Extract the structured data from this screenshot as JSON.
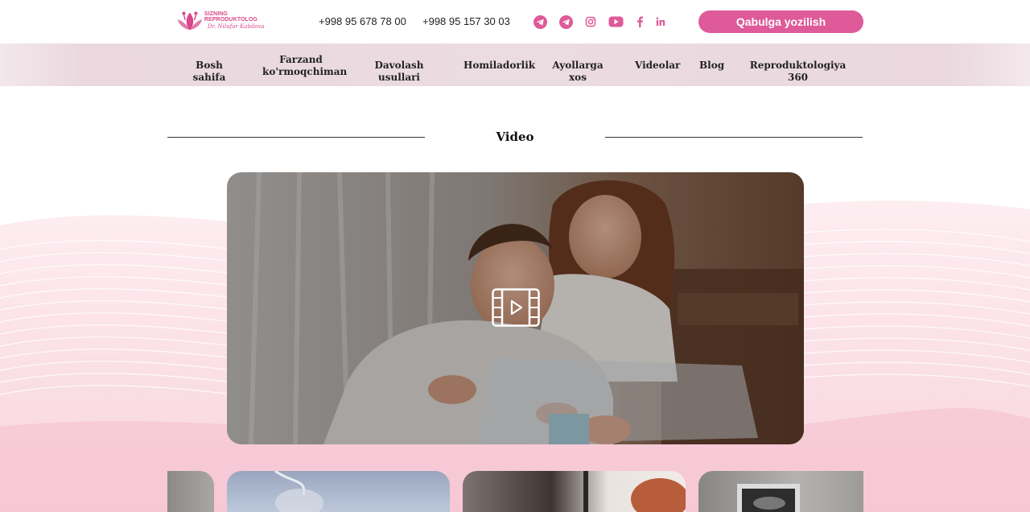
{
  "header": {
    "logo": {
      "title": "SIZNING REPRODUKTOLOG",
      "subtitle": "Dr. Nilufar Kabilova"
    },
    "phones": [
      "+998 95 678 78 00",
      "+998 95 157 30 03"
    ],
    "social_icons": [
      "telegram-icon",
      "telegram-icon",
      "instagram-icon",
      "youtube-icon",
      "facebook-icon",
      "linkedin-icon"
    ],
    "cta_label": "Qabulga yozilish",
    "accent_color": "#de5a98"
  },
  "nav": {
    "items": [
      {
        "label": "Bosh sahifa"
      },
      {
        "label": "Farzand",
        "label2": "ko'rmoqchiman"
      },
      {
        "label": "Davolash usullari"
      },
      {
        "label": "Homiladorlik"
      },
      {
        "label": "Ayollarga xos"
      },
      {
        "label": "Videolar"
      },
      {
        "label": "Blog"
      },
      {
        "label": "Reproduktologiya 360"
      }
    ]
  },
  "section": {
    "title": "Video"
  },
  "video": {
    "icon": "video-play-icon"
  }
}
